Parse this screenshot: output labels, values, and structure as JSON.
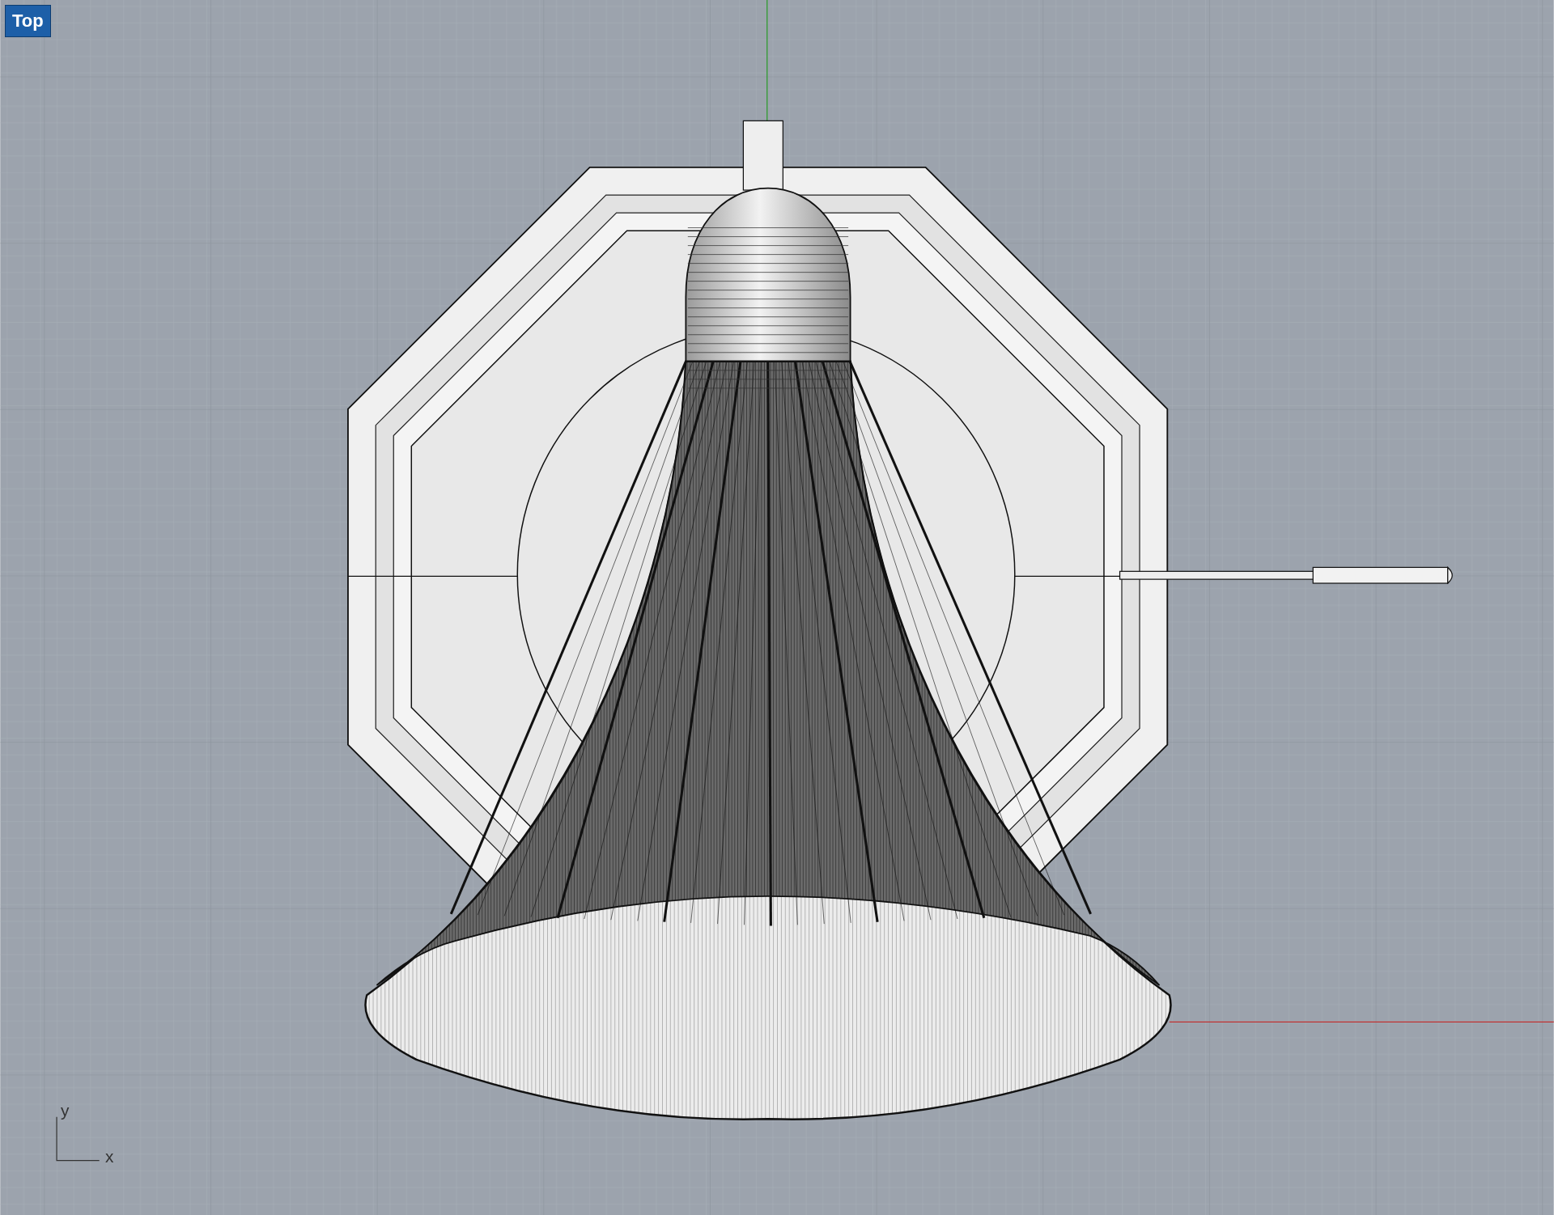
{
  "viewport": {
    "title": "Top"
  },
  "axis_icon": {
    "y_label": "y",
    "x_label": "x"
  }
}
